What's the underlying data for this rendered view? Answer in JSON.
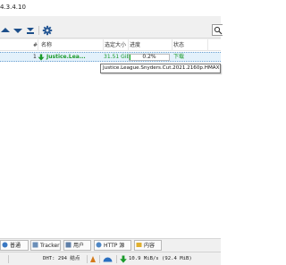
{
  "window": {
    "title_fragment": "4.3.4.10"
  },
  "toolbar": {
    "buttons": [
      {
        "name": "move-up-icon"
      },
      {
        "name": "move-down-icon"
      },
      {
        "name": "move-bottom-icon"
      },
      {
        "name": "gear-icon"
      }
    ]
  },
  "table": {
    "columns": [
      "#",
      "名称",
      "选定大小",
      "进度",
      "状态"
    ],
    "rows": [
      {
        "index": "1",
        "name": "Justice.Lea...",
        "size": "31.51 GiB",
        "progress_text": "0.2%",
        "progress": 0.002,
        "status": "下载"
      }
    ],
    "tooltip": "Justice.League.Snyders.Cut.2021.2160p.HMAX.WEB-DLx265.1"
  },
  "tabs": [
    {
      "label": "普通"
    },
    {
      "label": "Tracker"
    },
    {
      "label": "用户"
    },
    {
      "label": "HTTP 源"
    },
    {
      "label": "内容"
    }
  ],
  "status": {
    "dht": "DHT: 294 结点",
    "speed": "10.9 MiB/s (92.4 MiB)"
  },
  "colors": {
    "progress": "#16b02a",
    "download_text": "#1a9a2a",
    "status_blue": "#2a6fc0"
  }
}
